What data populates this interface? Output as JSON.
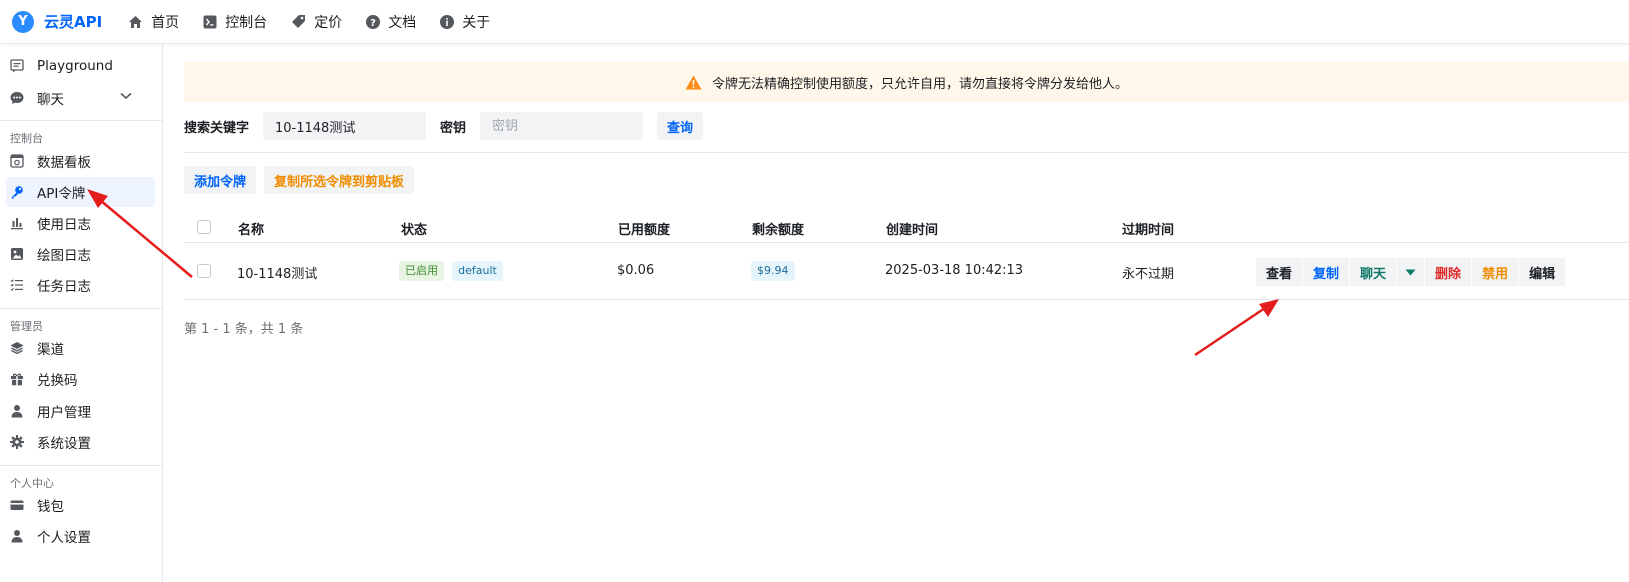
{
  "app": {
    "logo_glyph": "Y",
    "brand": "云灵API",
    "accent_color": "#0064fa"
  },
  "topnav": [
    {
      "label": "首页",
      "icon": "home-icon"
    },
    {
      "label": "控制台",
      "icon": "terminal-icon"
    },
    {
      "label": "定价",
      "icon": "tag-icon"
    },
    {
      "label": "文档",
      "icon": "help-icon"
    },
    {
      "label": "关于",
      "icon": "info-icon"
    }
  ],
  "sidebar": {
    "items": [
      {
        "label": "Playground",
        "icon": "chat-box-icon"
      },
      {
        "label": "聊天",
        "icon": "chat-bubble-icon"
      }
    ],
    "console_group": "控制台",
    "console_items": [
      {
        "label": "数据看板",
        "icon": "dashboard-icon"
      },
      {
        "label": "API令牌",
        "icon": "key-icon"
      },
      {
        "label": "使用日志",
        "icon": "bar-chart-icon"
      },
      {
        "label": "绘图日志",
        "icon": "image-icon"
      },
      {
        "label": "任务日志",
        "icon": "checklist-icon"
      }
    ],
    "admin_group": "管理员",
    "admin_items": [
      {
        "label": "渠道",
        "icon": "layers-icon"
      },
      {
        "label": "兑换码",
        "icon": "gift-icon"
      },
      {
        "label": "用户管理",
        "icon": "user-icon"
      },
      {
        "label": "系统设置",
        "icon": "gear-icon"
      }
    ],
    "personal_group": "个人中心",
    "personal_items": [
      {
        "label": "钱包",
        "icon": "wallet-icon"
      },
      {
        "label": "个人设置",
        "icon": "user-settings-icon"
      }
    ]
  },
  "banner": {
    "text": "令牌无法精确控制使用额度，只允许自用，请勿直接将令牌分发给他人。",
    "icon": "warning-icon"
  },
  "search": {
    "keyword_label": "搜索关键字",
    "keyword_value": "10-1148测试",
    "key_label": "密钥",
    "key_placeholder": "密钥",
    "query_button": "查询"
  },
  "toolbar": {
    "add_token": "添加令牌",
    "copy_selected": "复制所选令牌到剪贴板"
  },
  "table": {
    "headers": {
      "name": "名称",
      "status": "状态",
      "used": "已用额度",
      "remaining": "剩余额度",
      "created": "创建时间",
      "expire": "过期时间"
    },
    "rows": [
      {
        "name": "10-1148测试",
        "status": "已启用",
        "group": "default",
        "used": "$0.06",
        "remaining": "$9.94",
        "created": "2025-03-18 10:42:13",
        "expire": "永不过期",
        "actions": {
          "view": "查看",
          "copy": "复制",
          "chat": "聊天",
          "delete": "删除",
          "disable": "禁用",
          "edit": "编辑"
        }
      }
    ]
  },
  "pagination": {
    "text": "第 1 - 1 条，共 1 条"
  },
  "colors": {
    "banner_bg": "#fff8ea",
    "warning": "#fa8c16",
    "success_tag_bg": "#e8f5e3",
    "success_text": "#3b8a2e",
    "delete": "#e02b2b",
    "disable": "#f08c00",
    "chat": "#0f7a6a",
    "annotation_arrow": "#e51c1c"
  }
}
